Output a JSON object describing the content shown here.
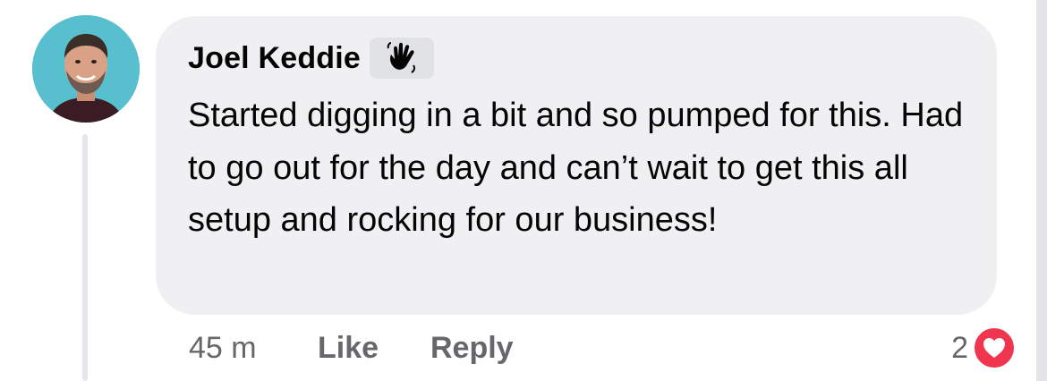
{
  "comment": {
    "author": "Joel Keddie",
    "badge_icon": "waving-hand-icon",
    "text": "Started digging in a bit and so pumped for this. Had to go out for the day and can’t wait to get this all setup and rocking for our business!",
    "time": "45 m",
    "like_label": "Like",
    "reply_label": "Reply",
    "reaction_count": "2",
    "reaction_type": "heart-icon"
  },
  "colors": {
    "bubble": "#f0f0f3",
    "meta_text": "#65676b",
    "heart": "#f0354e",
    "avatar_bg": "#58bfcf"
  }
}
